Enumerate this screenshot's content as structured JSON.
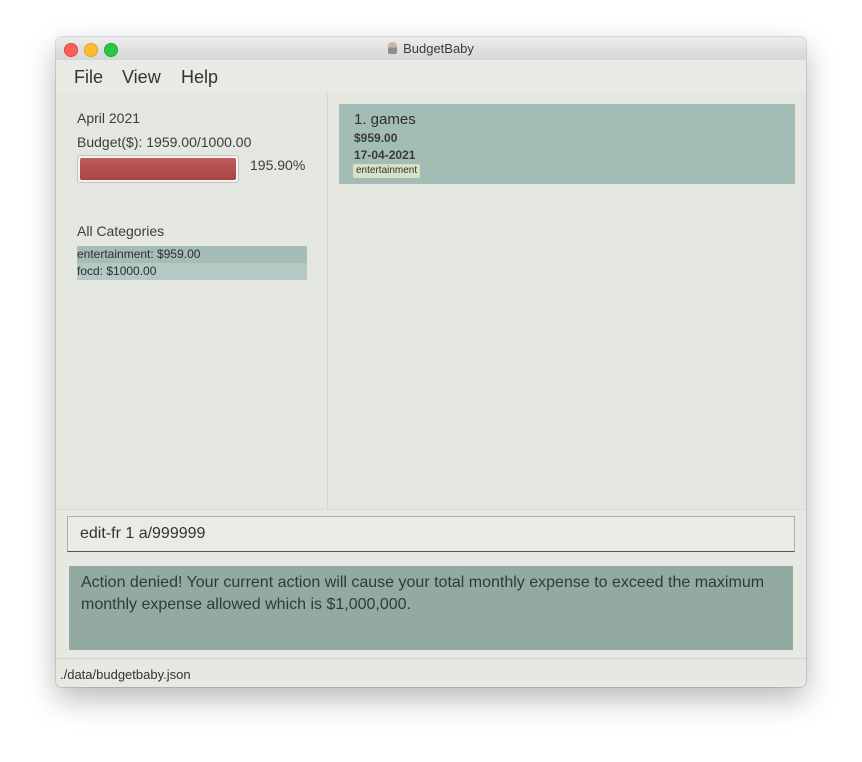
{
  "window": {
    "title": "BudgetBaby"
  },
  "menu": {
    "file": "File",
    "view": "View",
    "help": "Help"
  },
  "budget_panel": {
    "month": "April 2021",
    "budget": "Budget($): 1959.00/1000.00",
    "progress_fraction": 1.959,
    "percent": "195.90%",
    "categories_header": "All Categories",
    "categories": [
      {
        "label": "entertainment: $959.00"
      },
      {
        "label": "focd: $1000.00"
      }
    ]
  },
  "records": [
    {
      "title": "1.  games",
      "amount": "$959.00",
      "date": "17-04-2021",
      "tag": "entertainment"
    }
  ],
  "command": {
    "value": "edit-fr 1 a/999999"
  },
  "result": {
    "text": "Action denied! Your current action will cause your total monthly expense to exceed the maximum monthly expense allowed which is $1,000,000."
  },
  "status": {
    "path": "./data/budgetbaby.json"
  },
  "colors": {
    "progress_fill": "#b14e4c",
    "record_card": "#a4bcb6",
    "result_box": "#93aaa3"
  }
}
